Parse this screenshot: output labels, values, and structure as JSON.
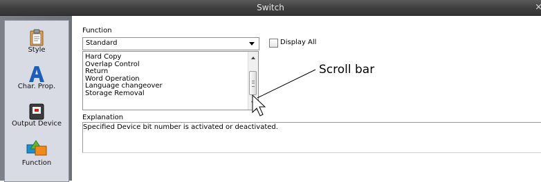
{
  "window": {
    "title": "Switch",
    "close_glyph": "×"
  },
  "sidebar": {
    "items": [
      {
        "label": "Style",
        "icon": "clipboard-icon"
      },
      {
        "label": "Char. Prop.",
        "icon": "letter-a-icon"
      },
      {
        "label": "Output Device",
        "icon": "device-icon"
      },
      {
        "label": "Function",
        "icon": "shapes-icon",
        "selected": true
      }
    ]
  },
  "function": {
    "label": "Function",
    "selected": "Standard",
    "display_all_label": "Display All",
    "display_all_checked": false,
    "list_items": [
      "Hard Copy",
      "Overlap Control",
      "Return",
      "Word Operation",
      "Language changeover",
      "Storage Removal"
    ]
  },
  "explanation": {
    "label": "Explanation",
    "text": "Specified Device bit number is activated or deactivated."
  },
  "annotation": {
    "label": "Scroll bar"
  },
  "colors": {
    "titlebar": "#3e3e3e",
    "sidebar_panel": "#d8dbe4",
    "icon_blue": "#1d5fb8",
    "icon_orange": "#f08a1c"
  }
}
